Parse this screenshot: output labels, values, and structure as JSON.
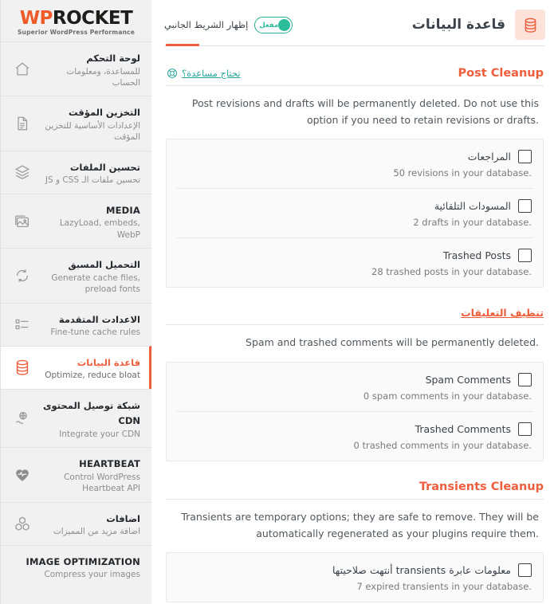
{
  "brand": {
    "logo_wp": "WP",
    "logo_rocket": "ROCKET",
    "tagline": "Superior WordPress Performance"
  },
  "header": {
    "icon": "database-icon",
    "title": "قاعدة البيانات",
    "toggle": {
      "label": "مفعل",
      "state": "on",
      "color": "#2ebd9a"
    },
    "sidebar_toggle_text": "إظهار الشريط الجانبي",
    "tab_accent": "#ef5e3c"
  },
  "sidebar": {
    "items": [
      {
        "icon": "home-icon",
        "title": "لوحة التحكم",
        "desc": "للمساعدة، ومعلومات الحساب",
        "dir": "rtl",
        "active": false
      },
      {
        "icon": "file-icon",
        "title": "التخزين المؤقت",
        "desc": "الإعدادات الأساسية للتخزين المؤقت",
        "dir": "rtl",
        "active": false
      },
      {
        "icon": "layers-icon",
        "title": "تحسين الملفات",
        "desc": "تحسين ملفات الـ CSS و JS",
        "dir": "rtl",
        "active": false
      },
      {
        "icon": "media-icon",
        "title": "MEDIA",
        "desc": "LazyLoad, embeds, WebP",
        "dir": "ltr",
        "active": false
      },
      {
        "icon": "refresh-icon",
        "title": "التحميل المسبق",
        "desc": "Generate cache files, preload fonts",
        "dir": "rtl",
        "active": false
      },
      {
        "icon": "list-icon",
        "title": "الاعدادت المتقدمة",
        "desc": "Fine-tune cache rules",
        "dir": "rtl",
        "active": false
      },
      {
        "icon": "database-icon",
        "title": "قاعدة البيانات",
        "desc": "Optimize, reduce bloat",
        "dir": "rtl",
        "active": true
      },
      {
        "icon": "cdn-icon",
        "title": "شبكة توصيل المحتوى CDN",
        "desc": "Integrate your CDN",
        "dir": "rtl",
        "active": false
      },
      {
        "icon": "heartbeat-icon",
        "title": "HEARTBEAT",
        "desc": "Control WordPress Heartbeat API",
        "dir": "ltr",
        "active": false
      },
      {
        "icon": "addons-icon",
        "title": "اضافات",
        "desc": "اضافة مزيد من المميزات",
        "dir": "rtl",
        "active": false
      },
      {
        "icon": "none",
        "title": "IMAGE OPTIMIZATION",
        "desc": "Compress your images",
        "dir": "ltr",
        "active": false
      }
    ]
  },
  "sections": [
    {
      "title": "Post Cleanup",
      "title_dir": "ltr",
      "help": {
        "label": "تحتاج مساعدة؟",
        "icon": "lifebuoy-icon"
      },
      "desc": "Post revisions and drafts will be permanently deleted. Do not use this option if you need to retain revisions or drafts.",
      "rows": [
        {
          "label": "المراجعات",
          "label_dir": "rtl",
          "sub": "50 revisions in your database.",
          "checked": false
        },
        {
          "label": "المسودات التلقائية",
          "label_dir": "rtl",
          "sub": "2 drafts in your database.",
          "checked": false
        },
        {
          "label": "Trashed Posts",
          "label_dir": "ltr",
          "sub": "28 trashed posts in your database.",
          "checked": false
        }
      ]
    },
    {
      "title": "تنظيف التعليقات",
      "title_dir": "rtl",
      "help": null,
      "desc": "Spam and trashed comments will be permanently deleted.",
      "rows": [
        {
          "label": "Spam Comments",
          "label_dir": "ltr",
          "sub": "0 spam comments in your database.",
          "checked": false
        },
        {
          "label": "Trashed Comments",
          "label_dir": "ltr",
          "sub": "0 trashed comments in your database.",
          "checked": false
        }
      ]
    },
    {
      "title": "Transients Cleanup",
      "title_dir": "ltr",
      "help": null,
      "desc": "Transients are temporary options; they are safe to remove. They will be automatically regenerated as your plugins require them.",
      "rows": [
        {
          "label": "معلومات عابرة transients أنتهت صلاحيتها",
          "label_dir": "rtl",
          "sub": "7 expired transients in your database.",
          "checked": false
        }
      ]
    }
  ]
}
